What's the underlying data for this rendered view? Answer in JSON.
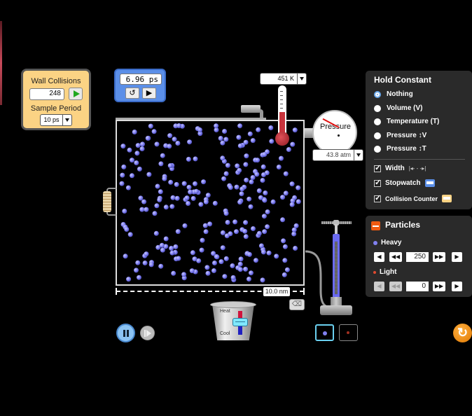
{
  "collision_counter": {
    "title": "Wall Collisions",
    "count": "248",
    "sample_period_label": "Sample Period",
    "sample_period_value": "10 ps",
    "accent": "#fbd384"
  },
  "stopwatch": {
    "time": "6.96 ps",
    "reset_icon": "↺",
    "play_icon": "▶",
    "accent": "#5b8fe8"
  },
  "thermometer": {
    "value": "451 K"
  },
  "pressure_gauge": {
    "label": "Pressure",
    "value": "43.8 atm"
  },
  "container": {
    "width_label": "10.0 nm",
    "heavy_particle_count": 250,
    "light_particle_count": 0,
    "particle_color": "#8080f0"
  },
  "heater": {
    "heat_label": "Heat",
    "cool_label": "Cool",
    "level": 0
  },
  "hold_constant": {
    "title": "Hold Constant",
    "options": [
      {
        "label": "Nothing",
        "selected": true
      },
      {
        "label": "Volume (V)",
        "selected": false
      },
      {
        "label": "Temperature (T)",
        "selected": false
      },
      {
        "label": "Pressure ↕V",
        "selected": false
      },
      {
        "label": "Pressure ↕T",
        "selected": false
      }
    ],
    "checkboxes": [
      {
        "label": "Width",
        "checked": true,
        "icon": "|◂- - -▸|"
      },
      {
        "label": "Stopwatch",
        "checked": true
      },
      {
        "label": "Collision Counter",
        "checked": true
      }
    ]
  },
  "particles": {
    "title": "Particles",
    "heavy_label": "Heavy",
    "heavy_value": "250",
    "heavy_color": "#8080f0",
    "light_label": "Light",
    "light_value": "0",
    "light_color": "#e04a30",
    "icons": {
      "dec1": "◀",
      "dec10": "◀◀",
      "inc10": "▶▶",
      "inc1": "▶"
    }
  },
  "eraser_icon": "⌫"
}
